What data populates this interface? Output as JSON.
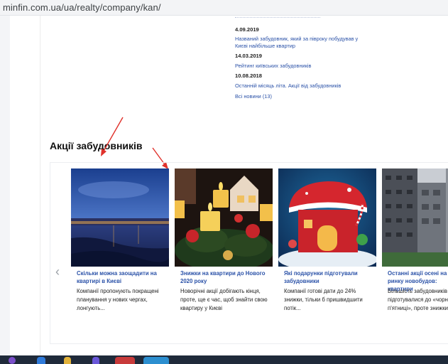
{
  "browser": {
    "url": "minfin.com.ua/ua/realty/company/kan/"
  },
  "news": {
    "items": [
      {
        "date": "4.09.2019",
        "text": "Названий забудовник, який за півроку побудував у Києві найбільше квартир"
      },
      {
        "date": "14.03.2019",
        "text": "Рейтинг київських забудовників"
      },
      {
        "date": "10.08.2018",
        "text": "Останній місяць літа. Акції від забудовників"
      }
    ],
    "all_news": "Всі новини (13)"
  },
  "section": {
    "title": "Акції забудовників"
  },
  "cards": [
    {
      "title": "Скільки можна заощадити на квартирі в Києві",
      "desc": "Компанії пропонують покращені планування у нових чергах, лонгують..."
    },
    {
      "title": "Знижки на квартири до Нового 2020 року",
      "desc": "Новорічні акції добігають кінця, проте, ще є час, щоб знайти свою квартиру у Києві"
    },
    {
      "title": "Які подарунки підготували забудовники",
      "desc": "Компанії готові дати до 24% знижки, тільки б пришвидшити потік..."
    },
    {
      "title": "Останні акції осені на ринку новобудов: квартири",
      "desc": "Більшість забудовників підготувалися до «чорної п'ятниці», проте знижки..."
    }
  ],
  "colors": {
    "link": "#2b52a8",
    "annotation_arrow": "#e0312b",
    "taskbar": "#1f2a3a"
  },
  "icons": {
    "carousel_prev": "chevron-left-icon"
  }
}
